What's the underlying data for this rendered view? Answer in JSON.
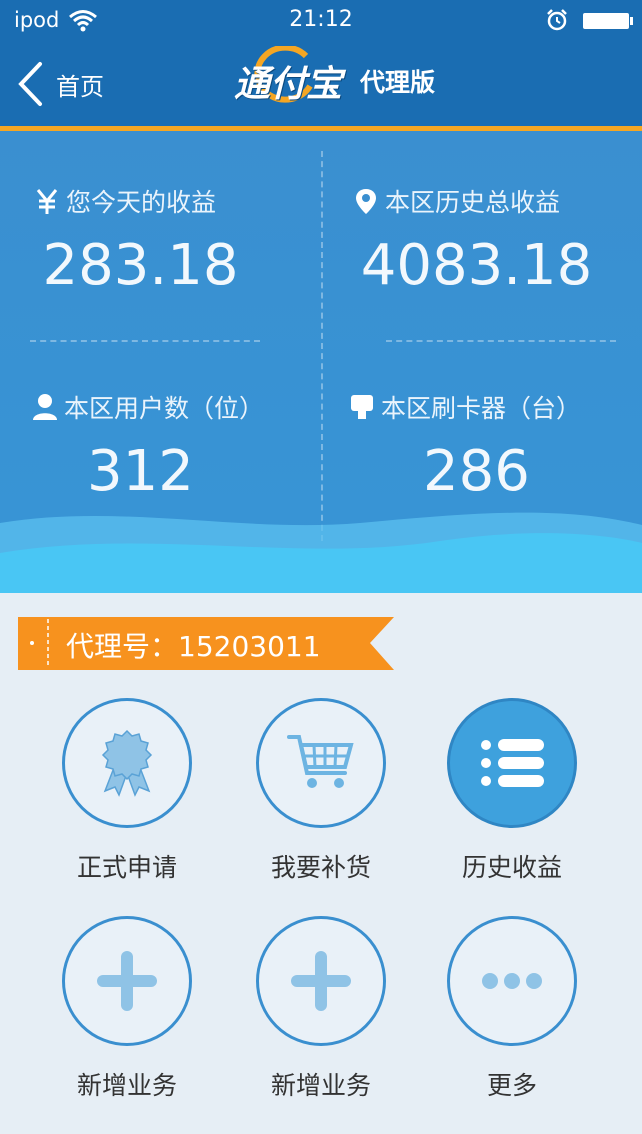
{
  "status_bar": {
    "carrier": "ipod",
    "time": "21:12"
  },
  "nav": {
    "back_label": "首页",
    "brand_logo": "通付宝",
    "edition": "代理版"
  },
  "stats": {
    "today_income": {
      "label": "您今天的收益",
      "value": "283.18",
      "icon": "yen-icon"
    },
    "district_total_income": {
      "label": "本区历史总收益",
      "value": "4083.18",
      "icon": "location-pin-icon"
    },
    "district_users": {
      "label": "本区用户数（位）",
      "value": "312",
      "icon": "user-icon"
    },
    "district_card_readers": {
      "label": "本区刷卡器（台）",
      "value": "286",
      "icon": "card-reader-icon"
    }
  },
  "agent": {
    "label": "代理号：15203011"
  },
  "actions": [
    {
      "label": "正式申请",
      "icon": "badge-ribbon-icon"
    },
    {
      "label": "我要补货",
      "icon": "shopping-cart-icon"
    },
    {
      "label": "历史收益",
      "icon": "list-icon"
    },
    {
      "label": "新增业务",
      "icon": "plus-icon"
    },
    {
      "label": "新增业务",
      "icon": "plus-icon"
    },
    {
      "label": "更多",
      "icon": "more-dots-icon"
    }
  ],
  "colors": {
    "header": "#1a6db2",
    "accent": "#f5a623",
    "stats_bg": "#3795d6",
    "tag": "#f7921e",
    "circle_border": "#3a8fcf"
  }
}
